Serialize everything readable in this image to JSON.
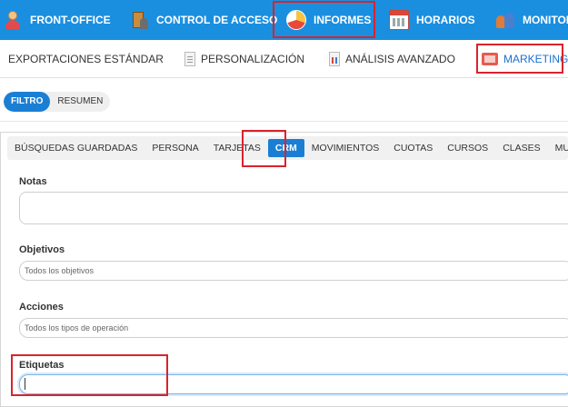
{
  "top_nav": {
    "items": [
      {
        "label": "FRONT-OFFICE",
        "icon": "user-icon"
      },
      {
        "label": "CONTROL DE ACCESO",
        "icon": "access-door-icon"
      },
      {
        "label": "INFORMES",
        "icon": "pie-chart-icon",
        "active": true
      },
      {
        "label": "HORARIOS",
        "icon": "calendar-icon"
      },
      {
        "label": "MONITOR",
        "icon": "people-icon"
      }
    ],
    "background_color": "#1a8fe0"
  },
  "sub_nav": {
    "items": [
      {
        "label": "EXPORTACIONES ESTÁNDAR"
      },
      {
        "label": "PERSONALIZACIÓN",
        "icon": "document-icon"
      },
      {
        "label": "ANÁLISIS AVANZADO",
        "icon": "report-chart-icon"
      },
      {
        "label": "MARKETING",
        "icon": "marketing-icon",
        "active": true
      }
    ]
  },
  "view_toggle": {
    "filter_label": "FILTRO",
    "summary_label": "RESUMEN",
    "selected": "FILTRO"
  },
  "tabs": [
    {
      "label": "BÚSQUEDAS GUARDADAS"
    },
    {
      "label": "PERSONA"
    },
    {
      "label": "TARJETAS"
    },
    {
      "label": "CRM",
      "active": true
    },
    {
      "label": "MOVIMIENTOS"
    },
    {
      "label": "CUOTAS"
    },
    {
      "label": "CURSOS"
    },
    {
      "label": "CLASES"
    },
    {
      "label": "MULTIPACKS"
    }
  ],
  "form": {
    "notes_label": "Notas",
    "notes_value": "",
    "objectives_label": "Objetivos",
    "objectives_placeholder": "Todos los objetivos",
    "actions_label": "Acciones",
    "actions_placeholder": "Todos los tipos de operación",
    "tags_label": "Etiquetas",
    "tags_value": ""
  },
  "colors": {
    "accent": "#1a7fd4",
    "highlight_box": "#d9232d"
  }
}
